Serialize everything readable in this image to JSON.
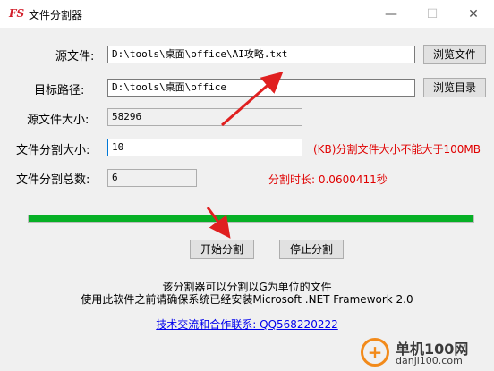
{
  "window": {
    "icon_text": "FS",
    "title": "文件分割器",
    "minimize": "—",
    "maximize": "☐",
    "close": "✕"
  },
  "form": {
    "source_label": "源文件:",
    "source_value": "D:\\tools\\桌面\\office\\AI攻略.txt",
    "browse_file": "浏览文件",
    "target_label": "目标路径:",
    "target_value": "D:\\tools\\桌面\\office",
    "browse_dir": "浏览目录",
    "size_label": "源文件大小:",
    "size_value": "58296",
    "split_size_label": "文件分割大小:",
    "split_size_value": "10",
    "split_size_note": "(KB)分割文件大小不能大于100MB",
    "total_label": "文件分割总数:",
    "total_value": "6",
    "duration_text": "分割时长: 0.0600411秒"
  },
  "progress": {
    "percent": 100,
    "color": "#06b025"
  },
  "actions": {
    "start": "开始分割",
    "stop": "停止分割"
  },
  "info": {
    "line1": "该分割器可以分割以G为单位的文件",
    "line2": "使用此软件之前请确保系统已经安装Microsoft .NET Framework 2.0",
    "link": "技术交流和合作联系: QQ568220222"
  },
  "watermark": {
    "icon": "+",
    "title": "单机100网",
    "url": "danji100.com"
  },
  "colors": {
    "accent_red": "#e00000",
    "arrow_red": "#e02020",
    "link": "#0000ee"
  }
}
